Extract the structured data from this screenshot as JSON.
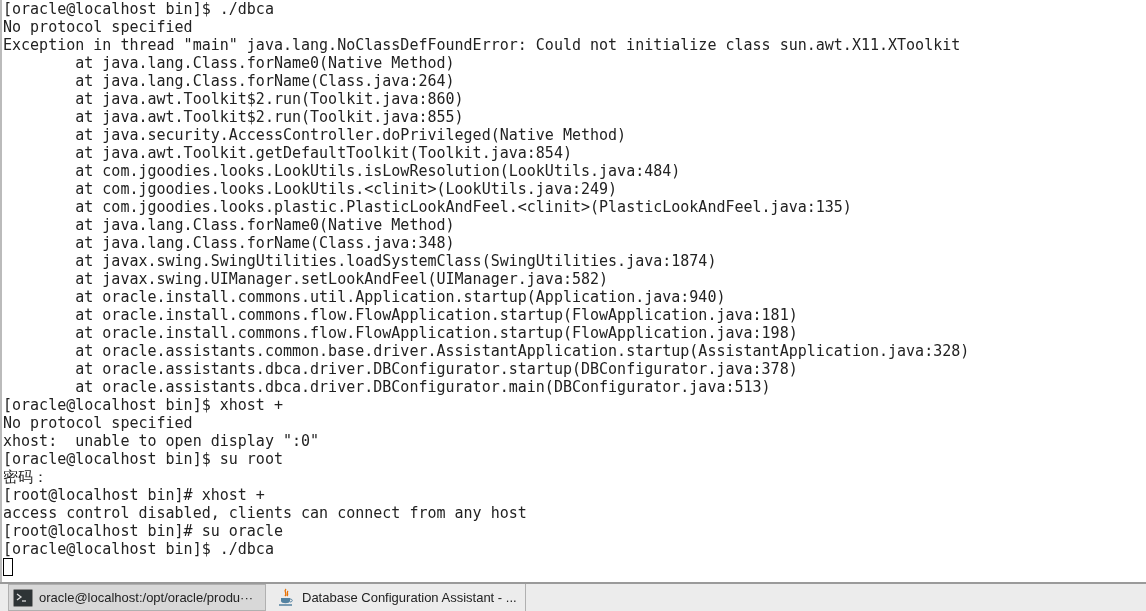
{
  "terminal": {
    "lines": [
      "[oracle@localhost bin]$ ./dbca",
      "No protocol specified",
      "Exception in thread \"main\" java.lang.NoClassDefFoundError: Could not initialize class sun.awt.X11.XToolkit",
      "\tat java.lang.Class.forName0(Native Method)",
      "\tat java.lang.Class.forName(Class.java:264)",
      "\tat java.awt.Toolkit$2.run(Toolkit.java:860)",
      "\tat java.awt.Toolkit$2.run(Toolkit.java:855)",
      "\tat java.security.AccessController.doPrivileged(Native Method)",
      "\tat java.awt.Toolkit.getDefaultToolkit(Toolkit.java:854)",
      "\tat com.jgoodies.looks.LookUtils.isLowResolution(LookUtils.java:484)",
      "\tat com.jgoodies.looks.LookUtils.<clinit>(LookUtils.java:249)",
      "\tat com.jgoodies.looks.plastic.PlasticLookAndFeel.<clinit>(PlasticLookAndFeel.java:135)",
      "\tat java.lang.Class.forName0(Native Method)",
      "\tat java.lang.Class.forName(Class.java:348)",
      "\tat javax.swing.SwingUtilities.loadSystemClass(SwingUtilities.java:1874)",
      "\tat javax.swing.UIManager.setLookAndFeel(UIManager.java:582)",
      "\tat oracle.install.commons.util.Application.startup(Application.java:940)",
      "\tat oracle.install.commons.flow.FlowApplication.startup(FlowApplication.java:181)",
      "\tat oracle.install.commons.flow.FlowApplication.startup(FlowApplication.java:198)",
      "\tat oracle.assistants.common.base.driver.AssistantApplication.startup(AssistantApplication.java:328)",
      "\tat oracle.assistants.dbca.driver.DBConfigurator.startup(DBConfigurator.java:378)",
      "\tat oracle.assistants.dbca.driver.DBConfigurator.main(DBConfigurator.java:513)",
      "[oracle@localhost bin]$ xhost +",
      "No protocol specified",
      "xhost:  unable to open display \":0\"",
      "[oracle@localhost bin]$ su root",
      "密码：",
      "[root@localhost bin]# xhost +",
      "access control disabled, clients can connect from any host",
      "[root@localhost bin]# su oracle",
      "[oracle@localhost bin]$ ./dbca"
    ]
  },
  "taskbar": {
    "items": [
      {
        "kind": "terminal",
        "label": "oracle@localhost:/opt/oracle/produ···",
        "selected": true
      },
      {
        "kind": "java",
        "label": "Database Configuration Assistant - ...",
        "selected": false
      }
    ]
  }
}
